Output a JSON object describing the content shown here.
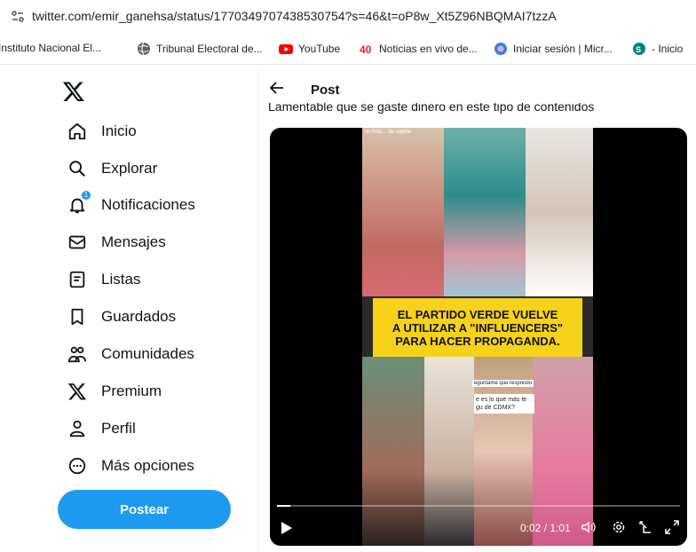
{
  "browser": {
    "url": "twitter.com/emir_ganehsa/status/1770349707438530754?s=46&t=oP8w_Xt5Z96NBQMAI7tzzA",
    "bookmarks": [
      {
        "label": "Instituto Nacional El...",
        "icon": "none"
      },
      {
        "label": "Tribunal Electoral de...",
        "icon": "globe-icon"
      },
      {
        "label": "YouTube",
        "icon": "youtube-icon"
      },
      {
        "label": "Noticias en vivo de...",
        "icon": "news-icon"
      },
      {
        "label": "Iniciar sesión | Micr...",
        "icon": "microsoft-icon"
      },
      {
        "label": "- Inicio",
        "icon": "sharepoint-icon"
      }
    ]
  },
  "sidebar": {
    "items": [
      {
        "label": "Inicio",
        "icon": "home-icon"
      },
      {
        "label": "Explorar",
        "icon": "search-icon"
      },
      {
        "label": "Notificaciones",
        "icon": "bell-icon",
        "badge": "1"
      },
      {
        "label": "Mensajes",
        "icon": "mail-icon"
      },
      {
        "label": "Listas",
        "icon": "list-icon"
      },
      {
        "label": "Guardados",
        "icon": "bookmark-icon"
      },
      {
        "label": "Comunidades",
        "icon": "communities-icon"
      },
      {
        "label": "Premium",
        "icon": "x-logo-icon"
      },
      {
        "label": "Perfil",
        "icon": "person-icon"
      },
      {
        "label": "Más opciones",
        "icon": "more-icon"
      }
    ],
    "post_button": "Postear"
  },
  "main": {
    "title": "Post",
    "tweet_text": "Lamentable que se gaste dinero en este tipo de contenidos",
    "video": {
      "banner_lines": [
        "EL PARTIDO VERDE VUELVE",
        "A UTILIZAR A \"INFLUENCERS\"",
        "PARA HACER PROPAGANDA."
      ],
      "overlay_top_left": "el Prac... de sophie",
      "overlay_mid": "eguntame que respondo",
      "overlay_question": "e es lo que más te gu de CDMX?",
      "time": "0:02 / 1:01",
      "progress": 0.033
    }
  },
  "colors": {
    "accent": "#1d9bf0",
    "banner": "#f7d21b"
  }
}
